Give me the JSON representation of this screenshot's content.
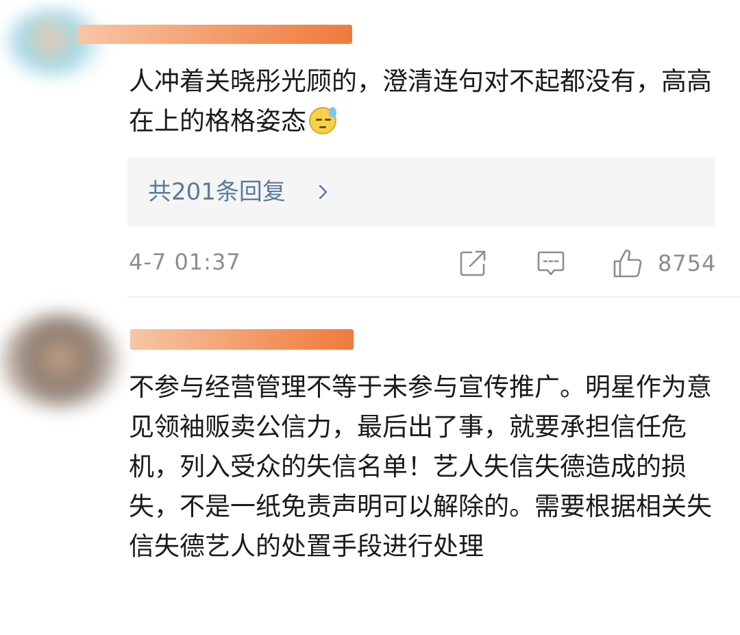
{
  "comments": [
    {
      "author_redacted": "████████",
      "text": "人冲着关晓彤光顾的，澄清连句对不起都没有，高高在上的格格姿态",
      "emoji": "sweat-face-emoji",
      "replies_label": "共201条回复",
      "timestamp": "4-7 01:37",
      "like_count": "8754"
    },
    {
      "author_redacted": "████████",
      "text": "不参与经营管理不等于未参与宣传推广。明星作为意见领袖贩卖公信力，最后出了事，就要承担信任危机，列入受众的失信名单！艺人失信失德造成的损失，不是一纸免责声明可以解除的。需要根据相关失信失德艺人的处置手段进行处理"
    }
  ],
  "icons": {
    "share": "share-icon",
    "comment": "comment-icon",
    "like": "like-icon",
    "chevron": "chevron-right-icon"
  },
  "colors": {
    "link": "#5b7a9a",
    "muted": "#8c8c8c",
    "redaction": "#f07a3c"
  }
}
